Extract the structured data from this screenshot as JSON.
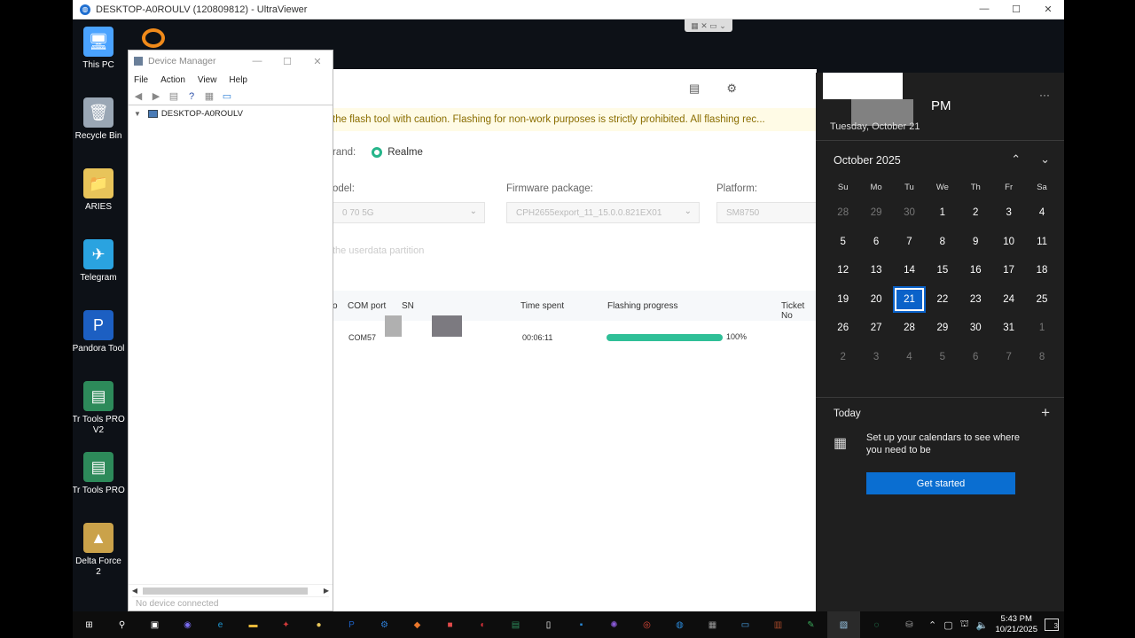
{
  "viewer": {
    "title": "DESKTOP-A0ROULV (120809812) - UltraViewer",
    "minimize": "—",
    "maximize": "☐",
    "close": "✕",
    "toolbar_glyphs": "▦ ✕ ▭ ⌄"
  },
  "desktop_icons": [
    {
      "label": "This PC",
      "icon": "computer-icon",
      "color": "#4aa3ff",
      "glyph": "🖥"
    },
    {
      "label": "Recycle Bin",
      "icon": "recycle-bin-icon",
      "color": "#9aa7b5",
      "glyph": "🗑"
    },
    {
      "label": "ARIES",
      "icon": "folder-user-icon",
      "color": "#e8c45a",
      "glyph": "📁"
    },
    {
      "label": "Telegram",
      "icon": "telegram-icon",
      "color": "#2aa3e0",
      "glyph": "✈"
    },
    {
      "label": "Pandora Tool",
      "icon": "pandora-icon",
      "color": "#1c5fc2",
      "glyph": "P"
    },
    {
      "label": "Tr Tools PRO V2",
      "icon": "tr-tools-icon",
      "color": "#2d8a5a",
      "glyph": "▤"
    },
    {
      "label": "Tr Tools PRO",
      "icon": "tr-tools-icon",
      "color": "#2d8a5a",
      "glyph": "▤"
    },
    {
      "label": "Delta Force 2",
      "icon": "delta-force-icon",
      "color": "#caa24a",
      "glyph": "▲"
    }
  ],
  "device_manager": {
    "title": "Device Manager",
    "menu": [
      "File",
      "Action",
      "View",
      "Help"
    ],
    "tree_root": "DESKTOP-A0ROULV",
    "status": "No device connected"
  },
  "flash_tool": {
    "warning": "the flash tool with caution. Flashing for non-work purposes is strictly prohibited. All flashing rec...",
    "brand_label": "rand:",
    "brand_value": "Realme",
    "model_label": "odel:",
    "model_value": "0 70 5G",
    "firmware_label": "Firmware package:",
    "firmware_value": "CPH2655export_11_15.0.0.821EX01",
    "platform_label": "Platform:",
    "platform_value": "SM8750",
    "userdata_text": "the userdata partition",
    "columns": [
      "o",
      "COM port",
      "SN",
      "Time spent",
      "Flashing progress",
      "Ticket No"
    ],
    "row": {
      "com_port": "COM57",
      "time_spent": "00:06:11",
      "progress_label": "100%",
      "progress": 1.0
    }
  },
  "calendar": {
    "pm": "PM",
    "date_line": "Tuesday, October 21",
    "month": "October 2025",
    "weekdays": [
      "Su",
      "Mo",
      "Tu",
      "We",
      "Th",
      "Fr",
      "Sa"
    ],
    "weeks": [
      [
        "28",
        "29",
        "30",
        "1",
        "2",
        "3",
        "4"
      ],
      [
        "5",
        "6",
        "7",
        "8",
        "9",
        "10",
        "11"
      ],
      [
        "12",
        "13",
        "14",
        "15",
        "16",
        "17",
        "18"
      ],
      [
        "19",
        "20",
        "21",
        "22",
        "23",
        "24",
        "25"
      ],
      [
        "26",
        "27",
        "28",
        "29",
        "30",
        "31",
        "1"
      ],
      [
        "2",
        "3",
        "4",
        "5",
        "6",
        "7",
        "8"
      ]
    ],
    "today": "21",
    "today_label": "Today",
    "setup_text": "Set up your calendars to see where you need to be",
    "get_started": "Get started"
  },
  "taskbar": {
    "time": "5:43 PM",
    "date": "10/21/2025",
    "notifications": "3",
    "icons": [
      {
        "name": "start-icon",
        "glyph": "⊞",
        "color": "#ffffff"
      },
      {
        "name": "search-icon",
        "glyph": "⚲",
        "color": "#ffffff"
      },
      {
        "name": "task-view-icon",
        "glyph": "▣",
        "color": "#ffffff"
      },
      {
        "name": "copilot-icon",
        "glyph": "◉",
        "color": "#7a6cf0"
      },
      {
        "name": "edge-icon",
        "glyph": "e",
        "color": "#1f9ad6"
      },
      {
        "name": "file-explorer-icon",
        "glyph": "▬",
        "color": "#e8b93a"
      },
      {
        "name": "app-red-icon",
        "glyph": "✦",
        "color": "#d33a3a"
      },
      {
        "name": "app-yellow-icon",
        "glyph": "●",
        "color": "#e6c55a"
      },
      {
        "name": "pandora-icon",
        "glyph": "P",
        "color": "#1c5fc2"
      },
      {
        "name": "settings-icon",
        "glyph": "⚙",
        "color": "#2d7ed6"
      },
      {
        "name": "app-orange-icon",
        "glyph": "◆",
        "color": "#e9772b"
      },
      {
        "name": "app-red-square-icon",
        "glyph": "■",
        "color": "#e04a4a"
      },
      {
        "name": "app-red-round-icon",
        "glyph": "◐",
        "color": "#d8303a"
      },
      {
        "name": "tr-tools-icon",
        "glyph": "▤",
        "color": "#2d8a5a"
      },
      {
        "name": "document-icon",
        "glyph": "▯",
        "color": "#ffffff"
      },
      {
        "name": "app-blue-icon",
        "glyph": "▪",
        "color": "#2a8ad8"
      },
      {
        "name": "app-purple-icon",
        "glyph": "✺",
        "color": "#8a5ad8"
      },
      {
        "name": "chrome-icon",
        "glyph": "◎",
        "color": "#e24a3a"
      },
      {
        "name": "ultraviewer-icon",
        "glyph": "◍",
        "color": "#2a88d8"
      },
      {
        "name": "app-gray-icon",
        "glyph": "▦",
        "color": "#9a9a9a"
      },
      {
        "name": "app-window-icon",
        "glyph": "▭",
        "color": "#4aa3e8"
      },
      {
        "name": "winrar-icon",
        "glyph": "▥",
        "color": "#a84a2a"
      },
      {
        "name": "app-green-icon",
        "glyph": "✎",
        "color": "#3aa85a"
      },
      {
        "name": "device-manager-icon",
        "glyph": "▧",
        "color": "#9ac8e8"
      },
      {
        "name": "flash-tool-icon",
        "glyph": "◌",
        "color": "#2fbf7a"
      },
      {
        "name": "app-network-icon",
        "glyph": "⛁",
        "color": "#aaaaaa"
      }
    ]
  }
}
